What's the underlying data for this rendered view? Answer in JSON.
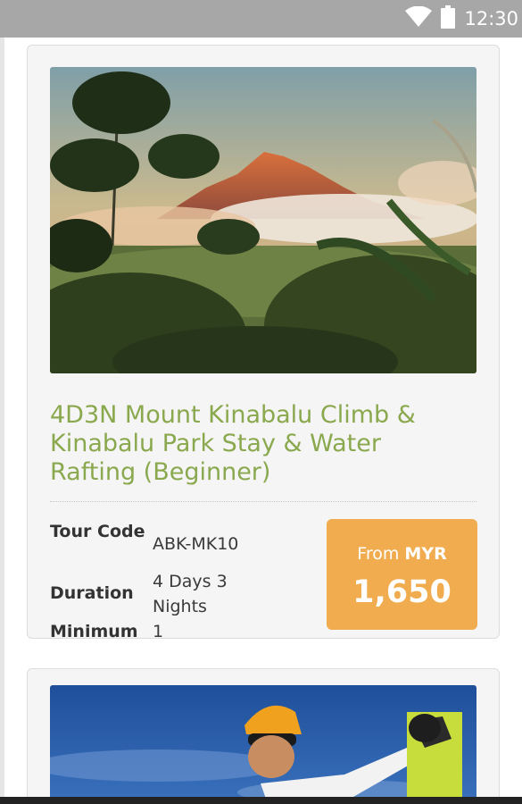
{
  "status_bar": {
    "time": "12:30"
  },
  "tours": [
    {
      "title": "4D3N Mount Kinabalu Climb & Kinabalu Park Stay & Water Rafting (Beginner)",
      "tour_code_label": "Tour Code",
      "tour_code": "ABK-MK10",
      "duration_label": "Duration",
      "duration": "4 Days 3 Nights",
      "minimum_label": "Minimum",
      "minimum": "1",
      "price_from": "From",
      "currency": "MYR",
      "price": "1,650"
    }
  ],
  "colors": {
    "title_green": "#8aa84e",
    "price_orange": "#f0ac4f"
  }
}
